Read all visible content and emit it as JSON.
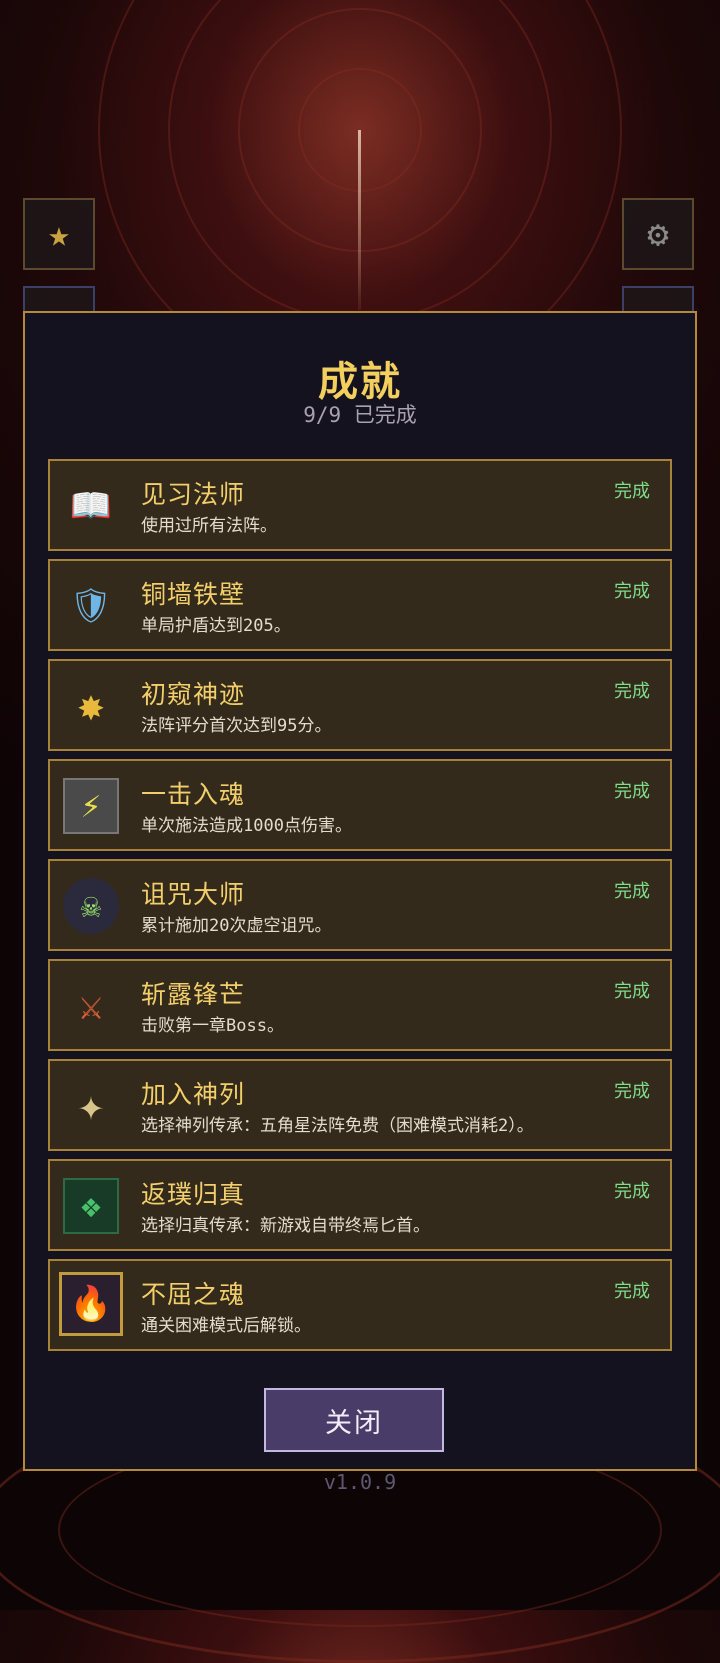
{
  "header": {
    "left_button_icon": "star-icon",
    "right_button_icon": "gear-icon"
  },
  "modal": {
    "title": "成就",
    "subtitle": "9/9 已完成",
    "close_label": "关闭"
  },
  "achievements": [
    {
      "title": "见习法师",
      "desc": "使用过所有法阵。",
      "status": "完成",
      "icon": "spellbook-icon",
      "glyph": "📖"
    },
    {
      "title": "铜墙铁壁",
      "desc": "单局护盾达到205。",
      "status": "完成",
      "icon": "shield-icon",
      "glyph": "🛡"
    },
    {
      "title": "初窥神迹",
      "desc": "法阵评分首次达到95分。",
      "status": "完成",
      "icon": "golden-star-badge-icon",
      "glyph": "✸"
    },
    {
      "title": "一击入魂",
      "desc": "单次施法造成1000点伤害。",
      "status": "完成",
      "icon": "flaming-fist-icon",
      "glyph": "⚡"
    },
    {
      "title": "诅咒大师",
      "desc": "累计施加20次虚空诅咒。",
      "status": "完成",
      "icon": "curse-skull-emblem-icon",
      "glyph": "☠"
    },
    {
      "title": "斩露锋芒",
      "desc": "击败第一章Boss。",
      "status": "完成",
      "icon": "boss-slayer-icon",
      "glyph": "⚔"
    },
    {
      "title": "加入神列",
      "desc": "选择神列传承：五角星法阵免费（困难模式消耗2）。",
      "status": "完成",
      "icon": "winged-star-emblem-icon",
      "glyph": "✦"
    },
    {
      "title": "返璞归真",
      "desc": "选择归真传承：新游戏自带终焉匕首。",
      "status": "完成",
      "icon": "green-rune-icon",
      "glyph": "❖"
    },
    {
      "title": "不屈之魂",
      "desc": "通关困难模式后解锁。",
      "status": "完成",
      "icon": "purple-flame-soul-icon",
      "glyph": "🔥"
    }
  ],
  "footer": {
    "version": "v1.0.9"
  },
  "colors": {
    "title": "#f3cf5e",
    "status": "#7fdc8a",
    "card_bg": "#332a1b",
    "card_border": "#a9823a",
    "modal_bg": "#15121f",
    "button_bg": "#4a3c69"
  }
}
